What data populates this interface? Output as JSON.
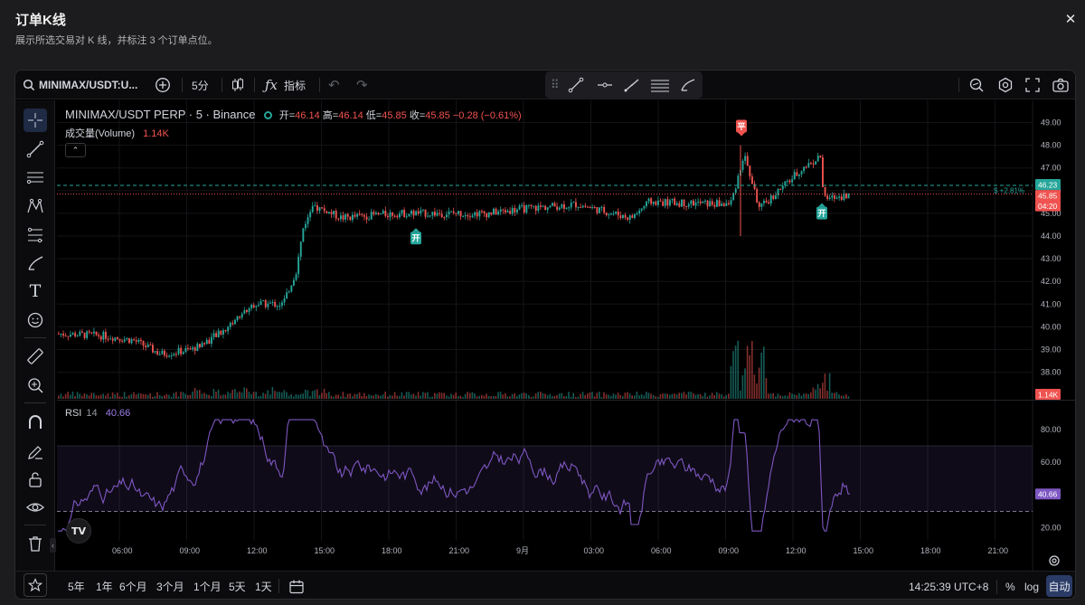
{
  "modal": {
    "title": "订单K线",
    "subtitle": "展示所选交易对 K 线，并标注 3 个订单点位。",
    "close": "✕"
  },
  "toolbar": {
    "symbol": "MINIMAX/USDT:U...",
    "interval": "5分",
    "indicators": "指标"
  },
  "legend": {
    "title": "MINIMAX/USDT PERP · 5 · Binance",
    "open_label": "开=",
    "open": "46.14",
    "high_label": "高=",
    "high": "46.14",
    "low_label": "低=",
    "low": "45.85",
    "close_label": "收=",
    "close": "45.85",
    "change": "−0.28 (−0.61%)",
    "volume_label": "成交量(Volume)",
    "volume": "1.14K",
    "rsi_label": "RSI",
    "rsi_period": "14",
    "rsi_value": "40.66"
  },
  "price_axis": {
    "ticks": [
      "49.00",
      "48.00",
      "47.00",
      "46.00",
      "45.00",
      "44.00",
      "43.00",
      "42.00",
      "41.00",
      "40.00",
      "39.00",
      "38.00"
    ],
    "tag_high": "46.23",
    "tag_last": "45.85",
    "tag_countdown": "04:20",
    "volume_tag": "1.14K",
    "pnl_note": "$ +2.81%"
  },
  "rsi_axis": {
    "ticks": [
      "80.00",
      "60.00",
      "40.00",
      "20.00"
    ],
    "tag": "40.66"
  },
  "time_axis": [
    "06:00",
    "09:00",
    "12:00",
    "15:00",
    "18:00",
    "21:00",
    "9月",
    "03:00",
    "06:00",
    "09:00",
    "12:00",
    "15:00",
    "18:00",
    "21:00"
  ],
  "markers": [
    {
      "label": "开",
      "kind": "open"
    },
    {
      "label": "平",
      "kind": "close"
    },
    {
      "label": "开",
      "kind": "open"
    }
  ],
  "bottom": {
    "ranges": [
      "5年",
      "1年",
      "6个月",
      "3个月",
      "1个月",
      "5天",
      "1天"
    ],
    "clock": "14:25:39 UTC+8",
    "percent": "%",
    "log": "log",
    "auto": "自动"
  },
  "colors": {
    "up": "#26a69a",
    "down": "#ef5350",
    "rsi": "#7e57c2",
    "accent": "#2962ff"
  },
  "chart_data": {
    "type": "candlestick",
    "symbol": "MINIMAX/USDT PERP",
    "interval": "5",
    "ylim": [
      37.5,
      49.5
    ],
    "key_points": [
      {
        "time": "05:00",
        "price": 39.7
      },
      {
        "time": "06:00",
        "price": 39.6
      },
      {
        "time": "07:00",
        "price": 39.4
      },
      {
        "time": "08:00",
        "price": 38.8
      },
      {
        "time": "09:00",
        "price": 39.0
      },
      {
        "time": "10:00",
        "price": 39.7
      },
      {
        "time": "11:00",
        "price": 41.0
      },
      {
        "time": "12:00",
        "price": 41.0
      },
      {
        "time": "13:00",
        "price": 42.5
      },
      {
        "time": "14:00",
        "price": 44.5
      },
      {
        "time": "15:00",
        "price": 45.3
      },
      {
        "time": "16:00",
        "price": 44.8
      },
      {
        "time": "18:00",
        "price": 45.0
      },
      {
        "time": "21:00",
        "price": 45.0
      },
      {
        "time": "00:00",
        "price": 45.2
      },
      {
        "time": "03:00",
        "price": 45.4
      },
      {
        "time": "05:00",
        "price": 44.8
      },
      {
        "time": "06:00",
        "price": 45.5
      },
      {
        "time": "09:00",
        "price": 45.4
      },
      {
        "time": "09:45",
        "price": 47.6
      },
      {
        "time": "10:30",
        "price": 45.2
      },
      {
        "time": "12:00",
        "price": 47.0
      },
      {
        "time": "13:00",
        "price": 47.5
      },
      {
        "time": "13:40",
        "price": 45.6
      },
      {
        "time": "14:25",
        "price": 45.85
      }
    ],
    "rsi_period": 14,
    "rsi_last": 40.66,
    "rsi_bands": [
      70,
      30
    ]
  }
}
